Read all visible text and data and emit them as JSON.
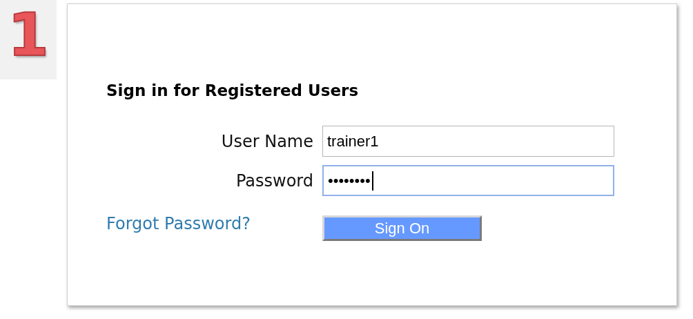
{
  "step_badge": "1",
  "heading": "Sign in for Registered Users",
  "fields": [
    {
      "label": "User Name",
      "value": "trainer1",
      "focused": false
    },
    {
      "label": "Password",
      "value": "••••••••",
      "focused": true
    }
  ],
  "forgot_link": "Forgot Password?",
  "submit_button": "Sign On"
}
